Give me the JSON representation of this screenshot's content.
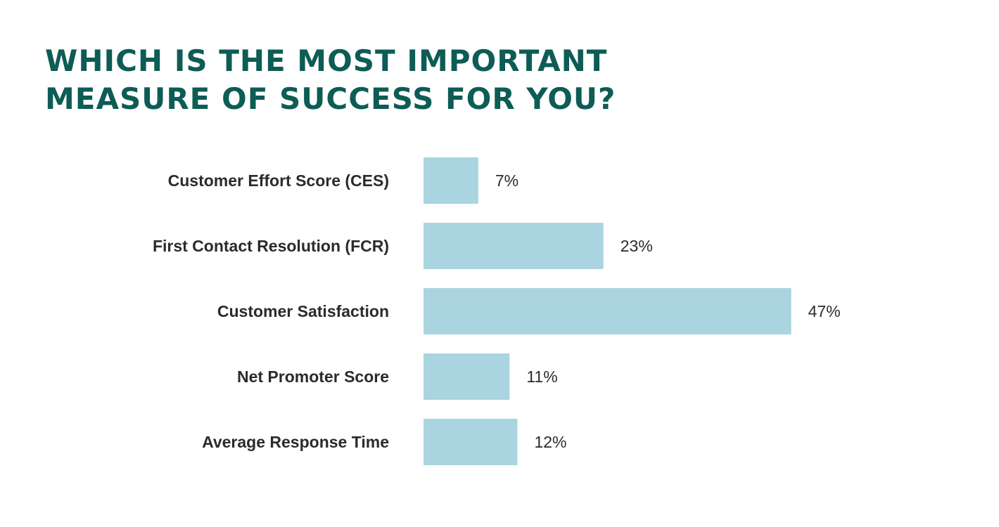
{
  "chart_data": {
    "type": "bar",
    "orientation": "horizontal",
    "title": "WHICH IS THE MOST IMPORTANT\nMEASURE OF SUCCESS FOR YOU?",
    "categories": [
      "Customer Effort Score (CES)",
      "First Contact Resolution (FCR)",
      "Customer Satisfaction",
      "Net Promoter Score",
      "Average Response Time"
    ],
    "values": [
      7,
      23,
      47,
      11,
      12
    ],
    "value_labels": [
      "7%",
      "23%",
      "47%",
      "11%",
      "12%"
    ],
    "unit": "%",
    "xlabel": "",
    "ylabel": "",
    "xlim": [
      0,
      50
    ],
    "grid": false,
    "legend": "none",
    "colors": {
      "bar": "#aad4df",
      "title": "#0d5c55",
      "text": "#2b2b2b"
    }
  }
}
